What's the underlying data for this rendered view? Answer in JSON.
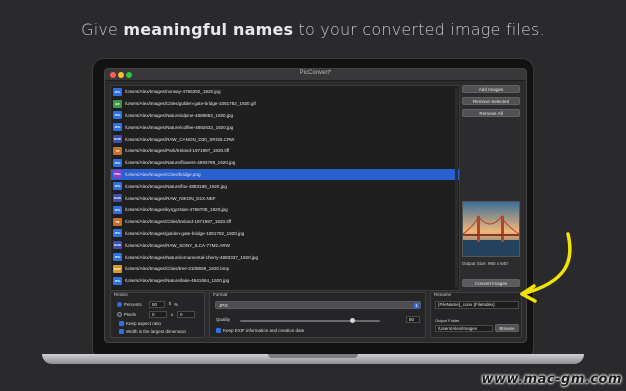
{
  "headline": {
    "pre": "Give ",
    "bold": "meaningful names",
    "post": " to your converted image files."
  },
  "window": {
    "title": "PicConvert*"
  },
  "files": [
    {
      "type": "JPG",
      "path": "/Users/Alex/Images/norway-4766392_1920.jpg",
      "color": "#2f6fe0"
    },
    {
      "type": "GIF",
      "path": "/Users/Alex/Images/Cities/golden-gate-bridge-1081782_1920.gif",
      "color": "#3a9a45"
    },
    {
      "type": "JPG",
      "path": "/Users/Alex/Images/Nature/alpine-4869863_1920.jpg",
      "color": "#2f6fe0"
    },
    {
      "type": "JPG",
      "path": "/Users/Alex/Images/Nature/coffee-4882632_1920.jpg",
      "color": "#2f6fe0"
    },
    {
      "type": "RAW",
      "path": "/Users/Alex/Images/RAW_CANON_D30_SRGB.CRW",
      "color": "#3b4fa8"
    },
    {
      "type": "TIF",
      "path": "/Users/Alex/Images/Park/Ireland-1971997_1920.tiff",
      "color": "#c8702a"
    },
    {
      "type": "JPG",
      "path": "/Users/Alex/Images/Nature/flowers-4893789_1920.jpg",
      "color": "#2f6fe0"
    },
    {
      "type": "PNG",
      "path": "/Users/Alex/Images/Cities/bridge.png",
      "color": "#8a3fc9"
    },
    {
      "type": "JPG",
      "path": "/Users/Alex/Images/Nature/fox-4883199_1920.jpg",
      "color": "#2f6fe0"
    },
    {
      "type": "RAW",
      "path": "/Users/Alex/Images/RAW_NIKON_D1X.NEF",
      "color": "#3b4fa8"
    },
    {
      "type": "JPG",
      "path": "/Users/Alex/Images/kyrgyzstan-4766708_1920.jpg",
      "color": "#2f6fe0"
    },
    {
      "type": "TIF",
      "path": "/Users/Alex/Images/Cities/Ireland-1971997_1920.tiff",
      "color": "#c8702a"
    },
    {
      "type": "JPG",
      "path": "/Users/Alex/Images/golden-gate-bridge-1081782_1920.jpg",
      "color": "#2f6fe0"
    },
    {
      "type": "RAW",
      "path": "/Users/Alex/Images/RAW_SONY_ILCA-77M2.ARW",
      "color": "#3b4fa8"
    },
    {
      "type": "JPG",
      "path": "/Users/Alex/Images/Nature/ornamental-cherry-4883337_1920.jpg",
      "color": "#2f6fe0"
    },
    {
      "type": "BMP",
      "path": "/Users/Alex/Images/Cities/tree-3108559_1920.bmp",
      "color": "#d39a2a"
    },
    {
      "type": "JPG",
      "path": "/Users/Alex/Images/Nature/lake-4841664_1920.jpg",
      "color": "#2f6fe0"
    }
  ],
  "selected_index": 7,
  "side": {
    "add": "Add Images",
    "remove_selected": "Remove Selected",
    "remove_all": "Remove All",
    "output_size": "Output Size: 960 x 640",
    "convert": "Convert Images"
  },
  "resize": {
    "label": "Resize",
    "percent_label": "Percents",
    "percent_value": "50",
    "percent_unit": "%",
    "pixels_label": "Pixels",
    "px_w": "0",
    "px_x": "x",
    "px_h": "0",
    "keep_ratio": "Keep aspect ratio",
    "largest": "Width is the largest dimension"
  },
  "format": {
    "label": "Format",
    "value": "JPG",
    "quality_label": "Quality",
    "quality_value": "80",
    "quality_fraction": 0.8,
    "keep_exif": "Keep EXIF information and creation date"
  },
  "rename": {
    "label": "Rename",
    "value": "{FileName}_conv {FileIndex}",
    "output_label": "Output Folder",
    "output_value": "/Users/Alex/Images",
    "browse": "Browse"
  },
  "watermark": "www.mac-gm.com",
  "colors": {
    "accent": "#2f6fe0",
    "arrow": "#f2e400"
  }
}
